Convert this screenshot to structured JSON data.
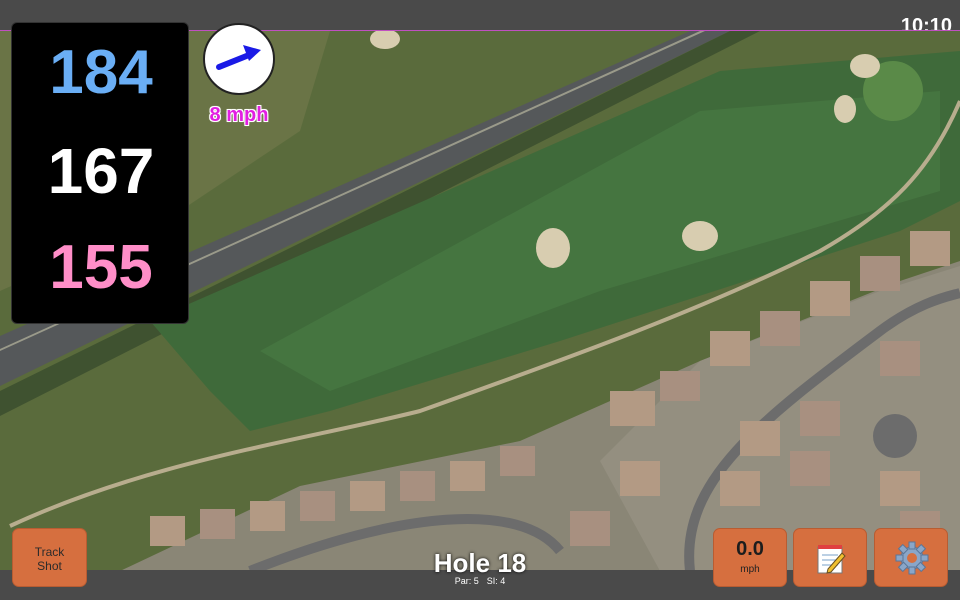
{
  "status": {
    "time": "10:10"
  },
  "distances": {
    "back": "184",
    "middle": "167",
    "front": "155",
    "back_color": "#6aaef5",
    "middle_color": "#ffffff",
    "front_color": "#ff8ec8"
  },
  "wind": {
    "speed_text": "8 mph",
    "arrow_color": "#1a1ae6",
    "speed_color": "#e21ee2"
  },
  "buttons": {
    "track_shot_line1": "Track",
    "track_shot_line2": "Shot",
    "speed_value": "0.0",
    "speed_unit": "mph",
    "notes_icon": "notepad-icon",
    "settings_icon": "gear-icon",
    "button_color": "#d66f3f"
  },
  "hole": {
    "title": "Hole 18",
    "par_text": "Par: 5",
    "si_text": "SI: 4"
  }
}
